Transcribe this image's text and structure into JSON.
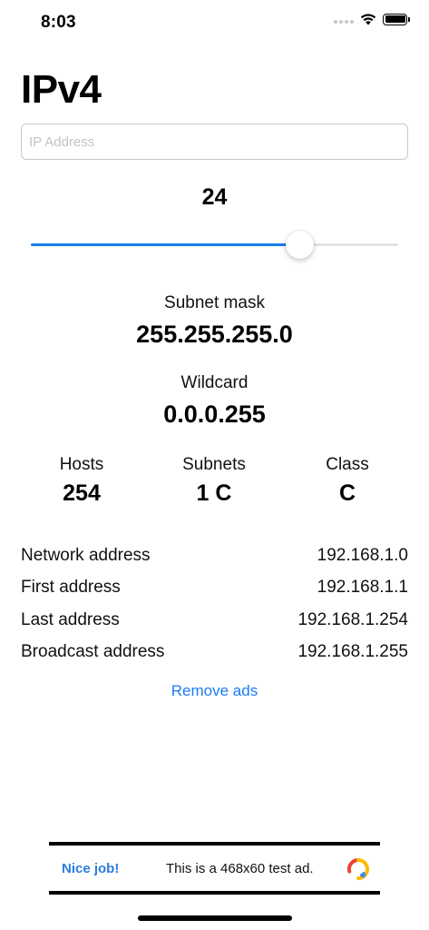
{
  "status_bar": {
    "time": "8:03"
  },
  "title": "IPv4",
  "ip_input": {
    "value": "",
    "placeholder": "IP Address"
  },
  "prefix": {
    "value": "24",
    "min": 0,
    "max": 32,
    "slider_fraction": 0.73
  },
  "subnet_mask": {
    "label": "Subnet mask",
    "value": "255.255.255.0"
  },
  "wildcard": {
    "label": "Wildcard",
    "value": "0.0.0.255"
  },
  "stats": {
    "hosts": {
      "label": "Hosts",
      "value": "254"
    },
    "subnets": {
      "label": "Subnets",
      "value": "1 C"
    },
    "class": {
      "label": "Class",
      "value": "C"
    }
  },
  "addresses": [
    {
      "label": "Network address",
      "value": "192.168.1.0"
    },
    {
      "label": "First address",
      "value": "192.168.1.1"
    },
    {
      "label": "Last address",
      "value": "192.168.1.254"
    },
    {
      "label": "Broadcast address",
      "value": "192.168.1.255"
    }
  ],
  "remove_ads_label": "Remove ads",
  "ad": {
    "label": "Nice job!",
    "text": "This is a 468x60 test ad."
  },
  "colors": {
    "accent": "#1a7cf0",
    "track": "#e3e3e6"
  }
}
